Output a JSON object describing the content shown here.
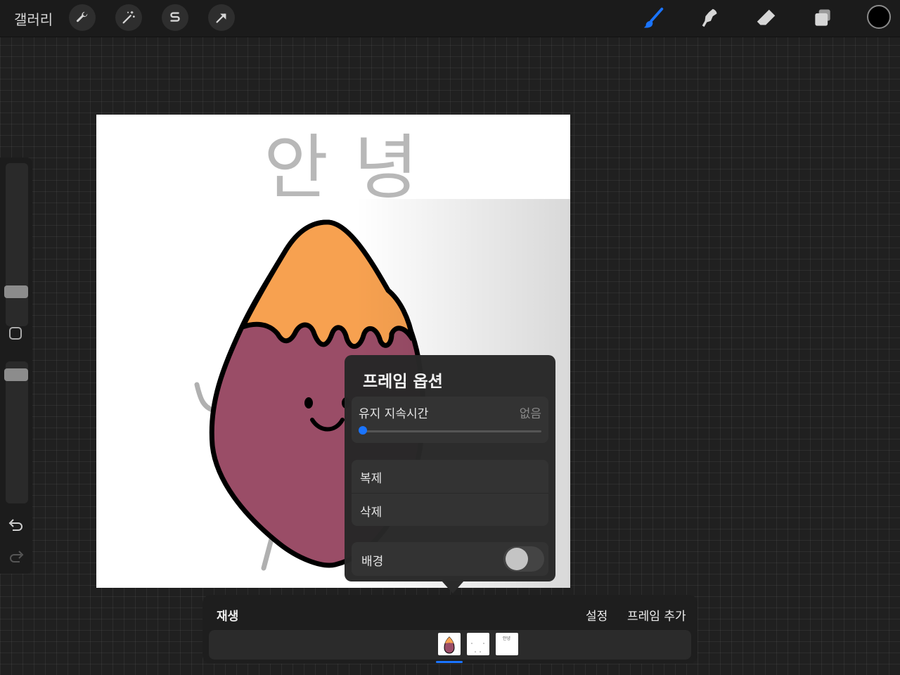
{
  "topbar": {
    "gallery_label": "갤러리",
    "left_tools": [
      "wrench-icon",
      "magic-wand-icon",
      "selection-s-icon",
      "transform-arrow-icon"
    ],
    "right_tools": [
      "brush-icon",
      "smudge-icon",
      "eraser-icon",
      "layers-icon"
    ],
    "active_tool_color": "#1a74ff",
    "current_color": "#000000"
  },
  "canvas": {
    "text": "안 녕",
    "potato_top_color": "#f7a150",
    "potato_body_color": "#9a4d67"
  },
  "frame_options": {
    "title": "프레임 옵션",
    "hold_duration_label": "유지 지속시간",
    "hold_duration_value": "없음",
    "hold_duration_level": 0,
    "duplicate_label": "복제",
    "delete_label": "삭제",
    "background_label": "배경",
    "background_on": false
  },
  "timeline": {
    "play_label": "재생",
    "settings_label": "설정",
    "add_frame_label": "프레임 추가",
    "frame_count": 3,
    "active_frame": 1,
    "frame3_mini_text": "안녕"
  }
}
